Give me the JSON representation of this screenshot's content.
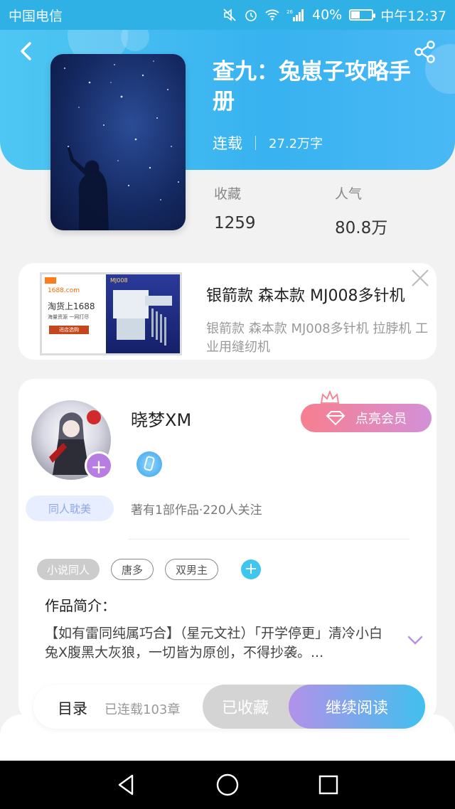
{
  "status_bar": {
    "carrier": "中国电信",
    "battery": "40%",
    "time": "中午12:37",
    "network": "26"
  },
  "book": {
    "title": "查九：兔崽子攻略手册",
    "status": "连载",
    "word_count": "27.2万字"
  },
  "stats": {
    "favorites_label": "收藏",
    "favorites_value": "1259",
    "popularity_label": "人气",
    "popularity_value": "80.8万"
  },
  "ad": {
    "title": "银箭款 森本款 MJ008多针机",
    "description": "银箭款 森本款 MJ008多针机 拉脖机 工业用缝纫机",
    "image_texts": [
      "1688.com",
      "淘货上1688",
      "海量资源 一网打尽",
      "进店选购",
      "MJ008"
    ]
  },
  "author": {
    "name": "晓梦XM",
    "genre_tag": "同人耽美",
    "stats": "著有1部作品·220人关注",
    "vip_button": "点亮会员"
  },
  "tags": [
    "小说同人",
    "唐多",
    "双男主"
  ],
  "intro": {
    "label": "作品简介：",
    "text": "【如有雷同纯属巧合】（星元文社）「开学停更」清冷小白兔X腹黑大灰狼，一切皆为原创，不得抄袭。..."
  },
  "bottom_bar": {
    "toc_label": "目录",
    "toc_count": "已连载103章",
    "favorited_button": "已收藏",
    "continue_button": "继续阅读"
  },
  "colors": {
    "header": "#38b2f0",
    "accent_purple": "#b77de0",
    "vip_pink": "#f77e8f",
    "tag_blue": "#3fc5ee"
  }
}
